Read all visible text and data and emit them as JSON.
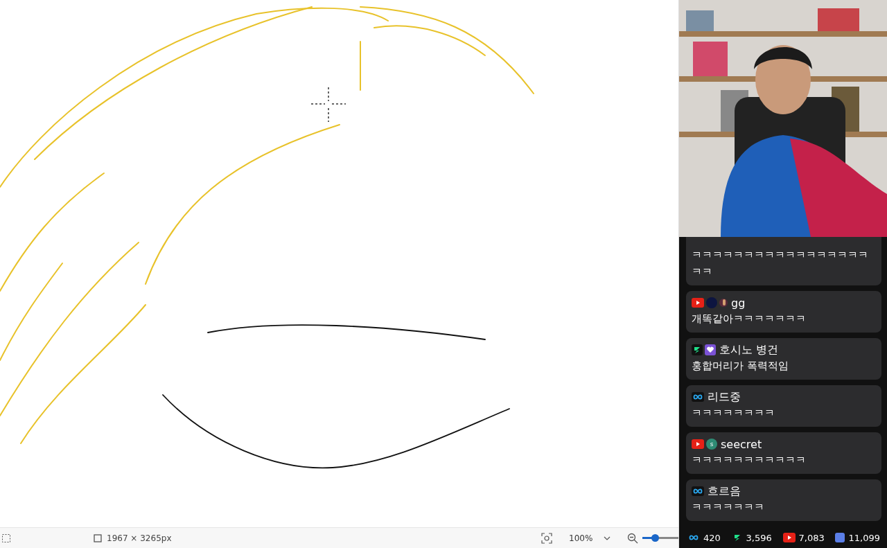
{
  "status_bar": {
    "dimensions": "1967 × 3265px",
    "zoom": "100%",
    "zoom_slider": {
      "level": 0.35
    }
  },
  "chat": {
    "messages": [
      {
        "text": "ㅋㅋㅋㅋㅋㅋㅋㅋㅋㅋㅋㅋㅋㅋㅋㅋㅋㅋㅋ"
      },
      {
        "badges": [
          {
            "kind": "youtube"
          },
          {
            "kind": "avatar",
            "color": "#0d1540"
          },
          {
            "kind": "sticker"
          }
        ],
        "name": "gg",
        "text": "개똑같아ㅋㅋㅋㅋㅋㅋㅋ"
      },
      {
        "badges": [
          {
            "kind": "chzzk"
          },
          {
            "kind": "heart"
          }
        ],
        "name": "호시노 병건",
        "text": "홍합머리가 폭력적임"
      },
      {
        "badges": [
          {
            "kind": "loop"
          }
        ],
        "name": "리드중",
        "text": "ㅋㅋㅋㅋㅋㅋㅋㅋ"
      },
      {
        "badges": [
          {
            "kind": "youtube"
          },
          {
            "kind": "avatar",
            "color": "#2e8b74",
            "letter": "s"
          }
        ],
        "name": "seecret",
        "text": "ㅋㅋㅋㅋㅋㅋㅋㅋㅋㅋㅋ"
      },
      {
        "badges": [
          {
            "kind": "loop"
          }
        ],
        "name": "흐르음",
        "text": "ㅋㅋㅋㅋㅋㅋㅋ"
      }
    ],
    "stats": [
      {
        "kind": "loop",
        "count": "420"
      },
      {
        "kind": "chzzk",
        "count": "3,596"
      },
      {
        "kind": "youtube",
        "count": "7,083"
      },
      {
        "kind": "other",
        "count": "11,099"
      }
    ]
  }
}
